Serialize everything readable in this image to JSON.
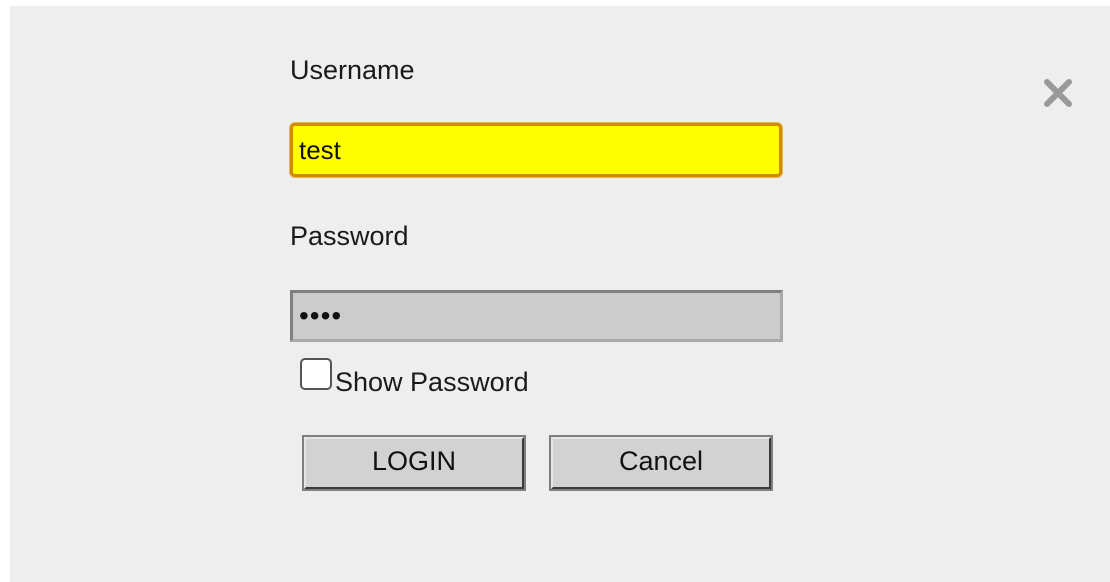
{
  "login_form": {
    "username": {
      "label": "Username",
      "value": "test"
    },
    "password": {
      "label": "Password",
      "value": "••••"
    },
    "show_password": {
      "label": "Show Password",
      "checked": false
    },
    "buttons": {
      "login": "LOGIN",
      "cancel": "Cancel"
    },
    "close_icon": "close-icon"
  },
  "colors": {
    "dialog_background": "#eeeeee",
    "username_field_background": "#ffff00",
    "username_field_focus_border": "#d18b00",
    "password_field_background": "#cccccc",
    "button_background": "#d2d2d2",
    "close_icon": "#999999"
  }
}
